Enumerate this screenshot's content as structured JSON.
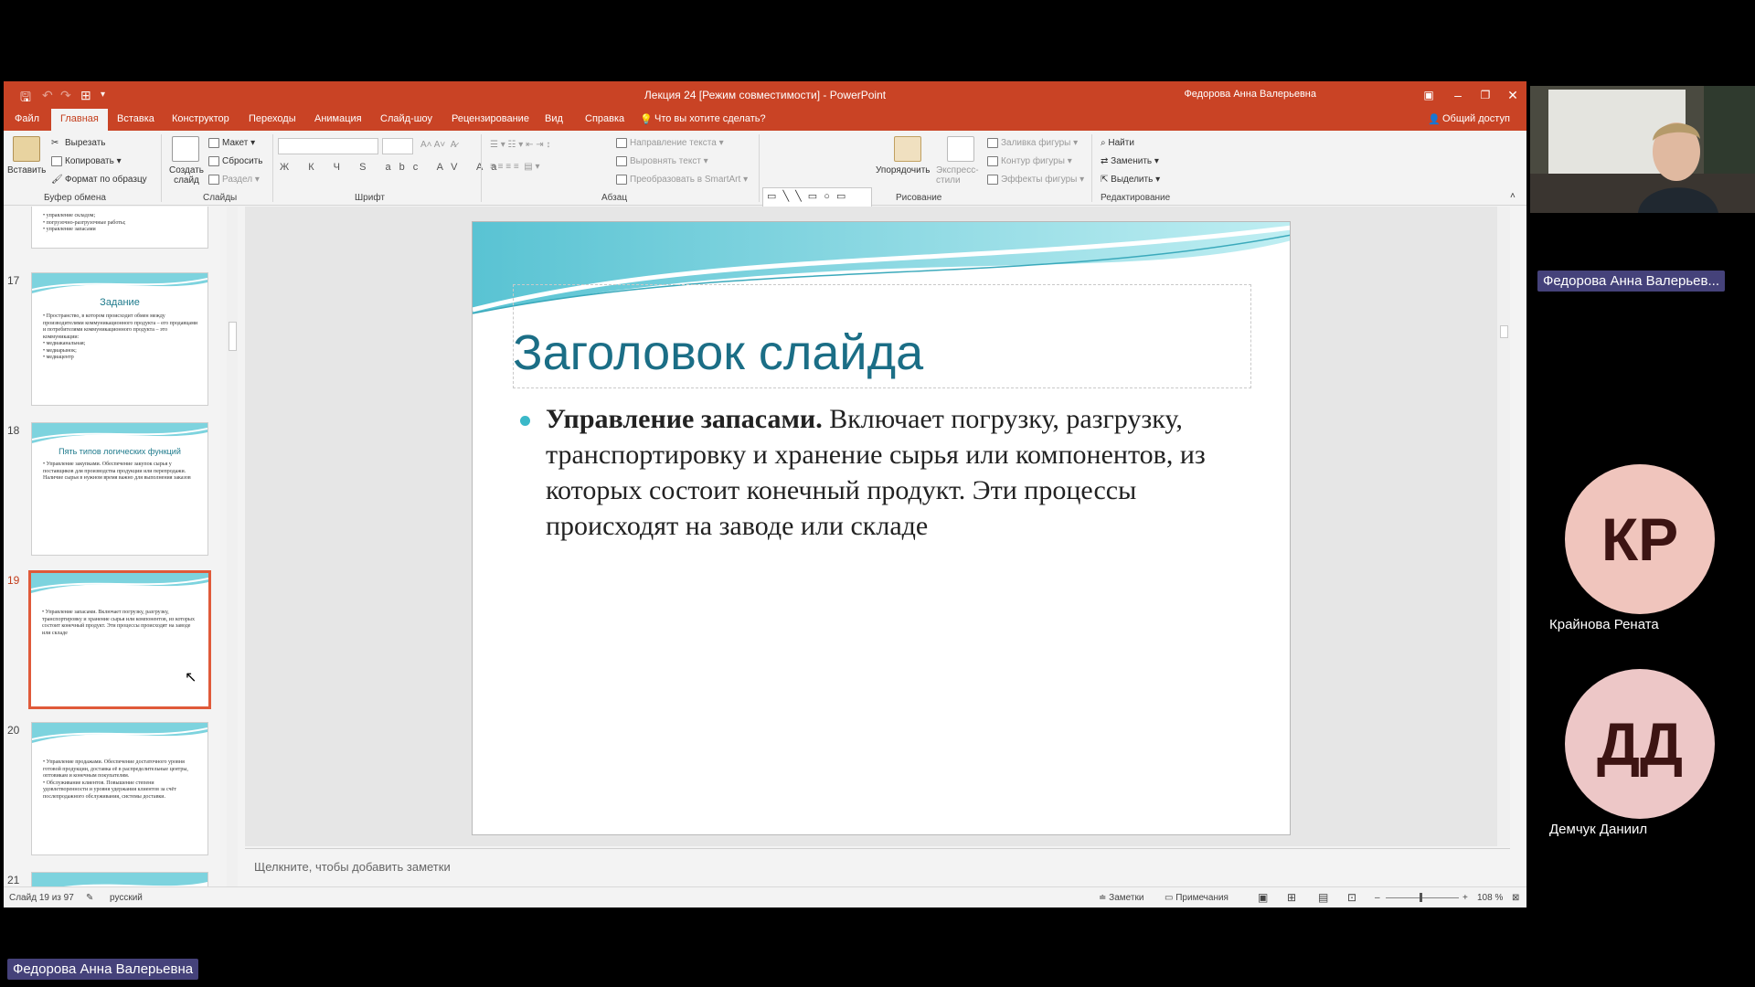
{
  "window": {
    "title": "Лекция 24 [Режим совместимости]  -  PowerPoint",
    "user": "Федорова Анна Валерьевна",
    "share": "Общий доступ"
  },
  "tabs": [
    "Файл",
    "Главная",
    "Вставка",
    "Конструктор",
    "Переходы",
    "Анимация",
    "Слайд-шоу",
    "Рецензирование",
    "Вид",
    "Справка"
  ],
  "tell_me": "Что вы хотите сделать?",
  "ribbon": {
    "clipboard": {
      "paste": "Вставить",
      "cut": "Вырезать",
      "copy": "Копировать",
      "format_painter": "Формат по образцу",
      "label": "Буфер обмена"
    },
    "slides": {
      "new_slide": "Создать слайд",
      "layout": "Макет",
      "reset": "Сбросить",
      "section": "Раздел",
      "label": "Слайды"
    },
    "font": {
      "label": "Шрифт",
      "buttons": "Ж К Ч S abc AV Aa"
    },
    "paragraph": {
      "text_direction": "Направление текста",
      "align_text": "Выровнять текст",
      "smartart": "Преобразовать в SmartArt",
      "label": "Абзац"
    },
    "drawing": {
      "arrange": "Упорядочить",
      "quick_styles": "Экспресс-стили",
      "fill": "Заливка фигуры",
      "outline": "Контур фигуры",
      "effects": "Эффекты фигуры",
      "label": "Рисование"
    },
    "editing": {
      "find": "Найти",
      "replace": "Заменить",
      "select": "Выделить",
      "label": "Редактирование"
    }
  },
  "thumbnails": [
    {
      "num": "",
      "title": "",
      "lines": [
        "• управление складом;",
        "• погрузочно-разгрузочные работы;",
        "• управление запасами"
      ]
    },
    {
      "num": "17",
      "title": "Задание",
      "lines": [
        "• Пространство, в котором происходит обмен между производителями коммуникационного продукта – его продавцами и потребителями коммуникационного продукта – это коммуникации:",
        "• медиаканальная;",
        "• медиарынок;",
        "• медиацентр"
      ]
    },
    {
      "num": "18",
      "title": "Пять типов логических функций",
      "lines": [
        "• Управление закупками. Обеспечение закупок сырья у поставщиков для производства продукции или перепродажи. Наличие сырья в нужном время важно для выполнения заказов"
      ]
    },
    {
      "num": "19",
      "title": "",
      "lines": [
        "• Управление запасами. Включает погрузку, разгрузку, транспортировку и хранение сырья или компонентов, из которых состоит конечный продукт. Эти процессы происходят на заводе или складе"
      ]
    },
    {
      "num": "20",
      "title": "",
      "lines": [
        "• Управление продажами. Обеспечение достаточного уровня готовой продукции, доставка её в распределительные центры, оптовикам и конечным покупателям.",
        "• Обслуживание клиентов. Повышение степени удовлетворенности и уровня удержания клиентов за счёт послепродажного обслуживания, системы доставки."
      ]
    },
    {
      "num": "21",
      "title": "",
      "lines": []
    }
  ],
  "slide": {
    "title": "Заголовок слайда",
    "bold": "Управление запасами.",
    "text": " Включает погрузку, разгрузку, транспортировку и хранение сырья или компонентов, из которых состоит конечный продукт. Эти процессы происходят на заводе или складе"
  },
  "notes_placeholder": "Щелкните, чтобы добавить заметки",
  "status": {
    "slide_counter": "Слайд 19 из 97",
    "language": "русский",
    "notes": "Заметки",
    "comments": "Примечания",
    "zoom": "108 %"
  },
  "conference": {
    "presenter_tag": "Федорова Анна Валерьев...",
    "presenter_bottom": "Федорова Анна Валерьевна",
    "participants": [
      {
        "initials": "КР",
        "name": "Крайнова Рената",
        "color": "#f0c5bd"
      },
      {
        "initials": "ДД",
        "name": "Демчук Даниил",
        "color": "#edc7c7"
      }
    ]
  }
}
